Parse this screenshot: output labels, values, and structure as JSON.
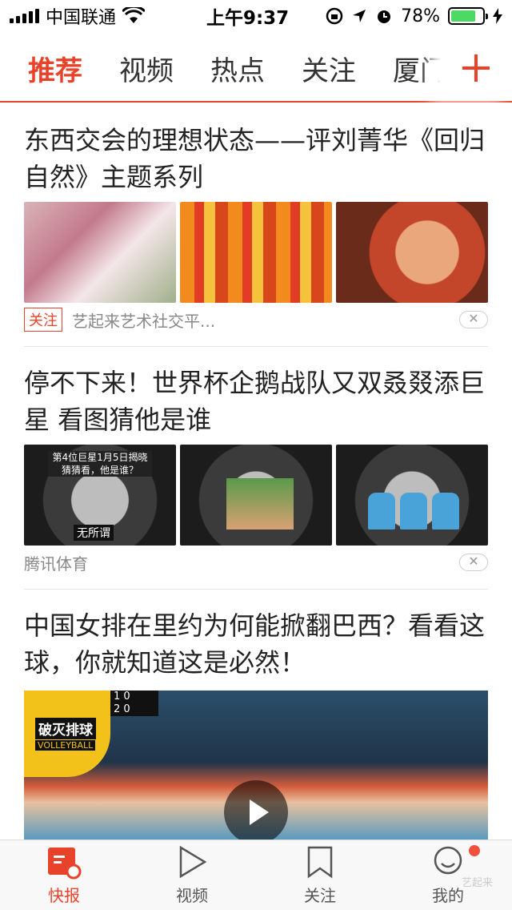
{
  "status_bar": {
    "carrier": "中国联通",
    "time": "上午9:37",
    "battery": "78%",
    "battery_level": 0.78,
    "icons": [
      "signal-icon",
      "wifi-icon",
      "rotation-lock-icon",
      "location-icon",
      "alarm-icon",
      "battery-icon",
      "charging-icon"
    ]
  },
  "tabs": {
    "items": [
      "推荐",
      "视频",
      "热点",
      "关注",
      "厦门"
    ],
    "active": "推荐",
    "add_icon": "plus-icon"
  },
  "feed": {
    "articles": [
      {
        "title": "东西交会的理想状态——评刘菁华《回归自然》主题系列",
        "follow_label": "关注",
        "source": "艺起来艺术社交平...",
        "dismiss_label": "✕"
      },
      {
        "title": "停不下来！世界杯企鹅战队又双叒叕添巨星 看图猜他是谁",
        "thumb_caption": "第4位巨星1月5日揭晓 猜猜看，他是谁？",
        "thumb_caption2": "无所谓",
        "source": "腾讯体育",
        "dismiss_label": "✕"
      },
      {
        "title": "中国女排在里约为何能掀翻巴西？看看这球，你就知道这是必然！",
        "video_logo": "破灭排球",
        "video_logo_sub": "VOLLEYBALL",
        "score_line1": "1 0",
        "score_line2": "2 0"
      }
    ]
  },
  "bottom_bar": {
    "items": [
      "快报",
      "视频",
      "关注",
      "我的"
    ],
    "active": "快报",
    "watermark": "艺起来"
  },
  "colors": {
    "accent": "#e8432a",
    "battery": "#4cd964"
  }
}
